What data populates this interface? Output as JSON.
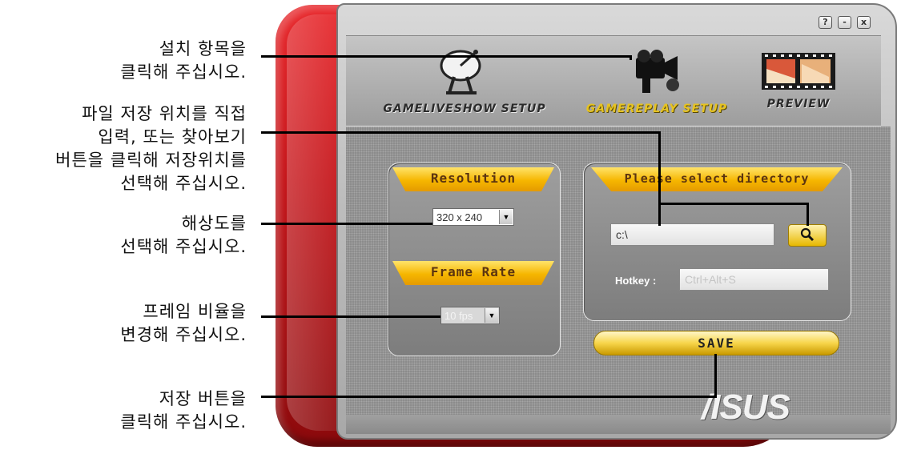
{
  "annotations": [
    {
      "lines": [
        "설치 항목을",
        "클릭해 주십시오."
      ]
    },
    {
      "lines": [
        "파일 저장 위치를 직접",
        "입력, 또는 찾아보기",
        "버튼을 클릭해 저장위치를",
        "선택해 주십시오."
      ]
    },
    {
      "lines": [
        "해상도를",
        "선택해 주십시오."
      ]
    },
    {
      "lines": [
        "프레임 비율을",
        "변경해 주십시오."
      ]
    },
    {
      "lines": [
        "저장 버튼을",
        "클릭해 주십시오."
      ]
    }
  ],
  "window_controls": {
    "help": "?",
    "minimize": "-",
    "close": "x"
  },
  "tabs": [
    {
      "label": "GAMELIVESHOW SETUP",
      "icon": "satellite-dish-icon",
      "active": false
    },
    {
      "label": "GAMEREPLAY SETUP",
      "icon": "video-camera-icon",
      "active": true
    },
    {
      "label": "PREVIEW",
      "icon": "film-strip-icon",
      "active": false
    }
  ],
  "resolution": {
    "title": "Resolution",
    "value": "320 x 240"
  },
  "frame_rate": {
    "title": "Frame Rate",
    "value": "10 fps"
  },
  "directory": {
    "title": "Please select directory",
    "path": "c:\\",
    "browse_icon": "magnifier-icon"
  },
  "hotkey": {
    "label": "Hotkey :",
    "value": "Ctrl+Alt+S"
  },
  "save_label": "SAVE",
  "brand": "/ISUS",
  "colors": {
    "accent": "#f6b600",
    "shell_red": "#c41217",
    "active_tab": "#e6c322"
  }
}
